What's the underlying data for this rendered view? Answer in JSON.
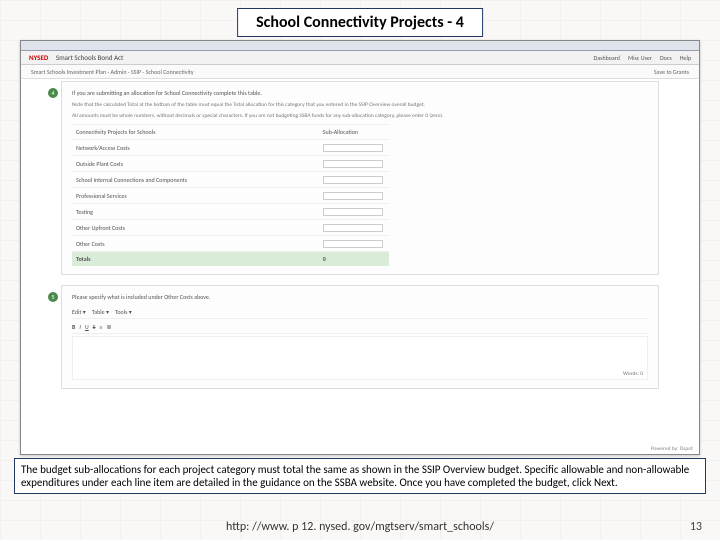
{
  "title": "School Connectivity Projects - 4",
  "app": {
    "logo": "NYSED",
    "name": "Smart Schools Bond Act",
    "nav": {
      "dashboard": "Dashboard",
      "user": "Misc User",
      "docs": "Docs",
      "help": "Help"
    },
    "breadcrumb": "Smart Schools Investment Plan - Admin - SSIP - School Connectivity",
    "saveGrants": "Save to Grants"
  },
  "panel4": {
    "num": "4",
    "instr": "If you are submitting an allocation for School Connectivity complete this table.",
    "note1": "Note that the calculated Total at the bottom of the table must equal the Total allocation for this category that you entered in the SSIP Overview overall budget.",
    "note2": "All amounts must be whole numbers, without decimals or special characters. If you are not budgeting SSBA funds for any sub-allocation category, please enter 0 (zero).",
    "headerLeft": "Connectivity Projects for Schools",
    "headerRight": "Sub-Allocation",
    "rows": [
      "Network/Access Costs",
      "Outside Plant Costs",
      "School Internal Connections and Components",
      "Professional Services",
      "Testing",
      "Other Upfront Costs",
      "Other Costs"
    ],
    "totalsLabel": "Totals",
    "totalsValue": "0"
  },
  "panel5": {
    "num": "5",
    "instr": "Please specify what is included under Other Costs above.",
    "menus": {
      "edit": "Edit ▾",
      "table": "Table ▾",
      "tools": "Tools ▾"
    },
    "buttons": {
      "bold": "B",
      "italic": "I",
      "under": "U",
      "strike": "S",
      "just": "≡",
      "list": "≣"
    },
    "words": "Words: 0"
  },
  "footerRight": "Powered by: Dspot",
  "caption": "The budget sub-allocations for each project category must total the same as shown in the SSIP Overview budget. Specific allowable and non-allowable expenditures under each line item are detailed in the guidance on the SSBA website. Once you have completed the budget, click Next.",
  "url": "http: //www. p 12. nysed. gov/mgtserv/smart_schools/",
  "page": "13"
}
